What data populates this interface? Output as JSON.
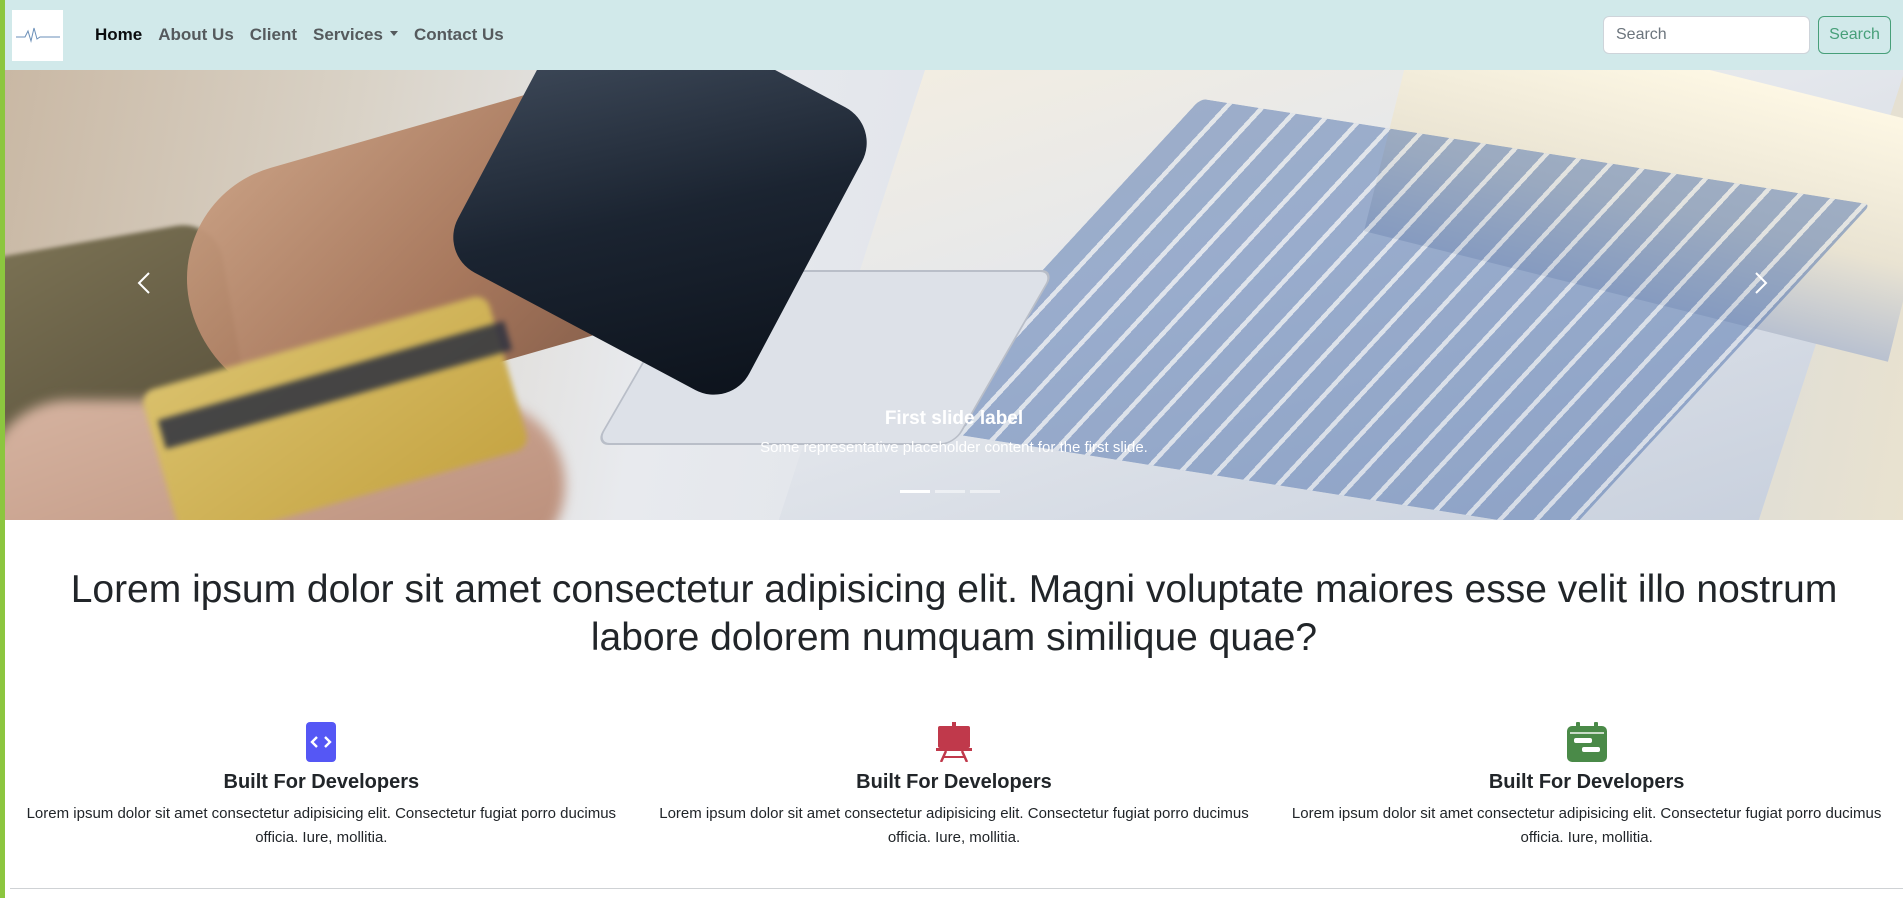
{
  "nav": {
    "links": [
      {
        "label": "Home"
      },
      {
        "label": "About Us"
      },
      {
        "label": "Client"
      },
      {
        "label": "Services"
      },
      {
        "label": "Contact Us"
      }
    ],
    "search_placeholder": "Search",
    "search_button": "Search"
  },
  "carousel": {
    "caption_title": "First slide label",
    "caption_text": "Some representative placeholder content for the first slide.",
    "slide_count": 3,
    "active_slide": 1
  },
  "lead": "Lorem ipsum dolor sit amet consectetur adipisicing elit. Magni voluptate maiores esse velit illo nostrum labore dolorem numquam similique quae?",
  "features": [
    {
      "title": "Built For Developers",
      "text": "Lorem ipsum dolor sit amet consectetur adipisicing elit. Consectetur fugiat porro ducimus officia. Iure, mollitia.",
      "icon": "code-icon",
      "color": "#5557f5"
    },
    {
      "title": "Built For Developers",
      "text": "Lorem ipsum dolor sit amet consectetur adipisicing elit. Consectetur fugiat porro ducimus officia. Iure, mollitia.",
      "icon": "easel-icon",
      "color": "#c0394b"
    },
    {
      "title": "Built For Developers",
      "text": "Lorem ipsum dolor sit amet consectetur adipisicing elit. Consectetur fugiat porro ducimus officia. Iure, mollitia.",
      "icon": "calendar-icon",
      "color": "#4a8a48"
    }
  ],
  "colors": {
    "navbar_bg": "#d1e9ea",
    "left_strip": "#8cc63f",
    "search_button": "#198754"
  }
}
